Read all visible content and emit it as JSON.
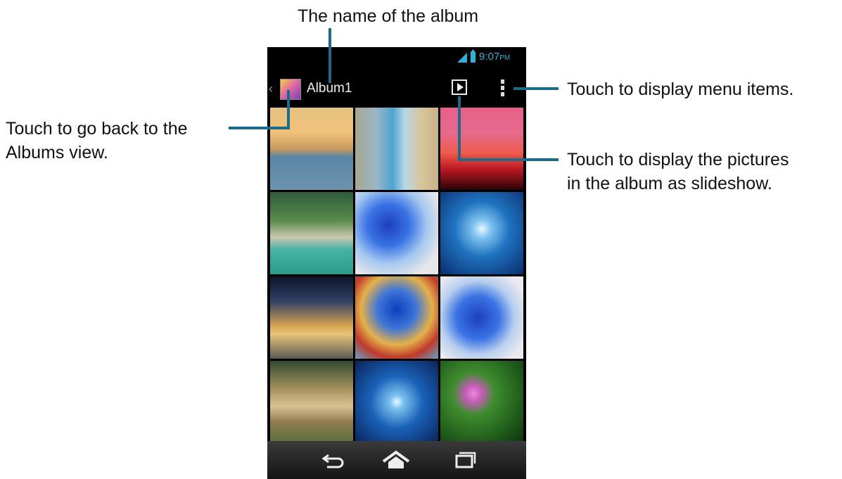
{
  "annotations": {
    "album_name": "The name of the album",
    "back_line1": "Touch to go back to the",
    "back_line2": "Albums view.",
    "menu": "Touch to display menu items.",
    "slideshow_line1": "Touch to display the pictures",
    "slideshow_line2": "in the album as slideshow."
  },
  "status_bar": {
    "time": "9:07",
    "ampm": "PM",
    "accent_color": "#2fb0d8"
  },
  "action_bar": {
    "album_title": "Album1",
    "back_icon": "chevron-left-icon",
    "slideshow_icon": "play-icon",
    "menu_icon": "overflow-menu-icon"
  },
  "photos": [
    "sunset-sea",
    "glass-bottle",
    "red-sunset",
    "coast-village",
    "pop-art-poster",
    "underwater-sun",
    "palm-beach-sunset",
    "pop-art-poster-2",
    "pop-art-poster-3",
    "stone-house",
    "underwater-sun-2",
    "water-lilies"
  ],
  "nav_bar": {
    "back_icon": "back-arrow-icon",
    "home_icon": "home-icon",
    "recent_icon": "recent-apps-icon"
  },
  "colors": {
    "callout_line": "#1b6b8a"
  }
}
